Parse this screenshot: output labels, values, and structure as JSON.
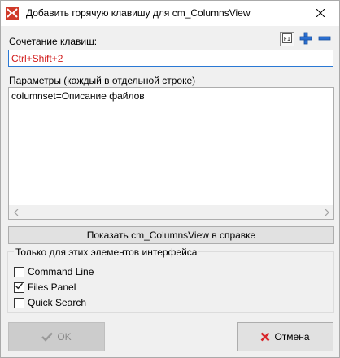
{
  "window": {
    "title": "Добавить горячую клавишу для cm_ColumnsView"
  },
  "hotkey": {
    "label_u": "С",
    "label_rest": "очетание клавиш:",
    "value": "Ctrl+Shift+2",
    "help_btn_label": "F1"
  },
  "params": {
    "label": "Параметры (каждый в отдельной строке)",
    "value": "columnset=Описание файлов"
  },
  "show_help_button": {
    "label": "Показать cm_ColumnsView в справке"
  },
  "scope_group": {
    "title": "Только для этих элементов интерфейса",
    "items": [
      {
        "label": "Command Line",
        "checked": false
      },
      {
        "label": "Files Panel",
        "checked": true
      },
      {
        "label": "Quick Search",
        "checked": false
      }
    ]
  },
  "buttons": {
    "ok": "OK",
    "cancel": "Отмена"
  },
  "icons": {
    "app": "double-commander-icon",
    "close": "close-icon",
    "help": "help-f1-icon",
    "add": "plus-icon",
    "remove": "minus-icon",
    "ok": "checkmark-icon",
    "cancel": "red-x-icon"
  },
  "colors": {
    "hotkey_text": "#d11a1a",
    "focus_border": "#2a78d4",
    "icon_blue": "#2b6fd0",
    "cancel_red": "#d9262b"
  }
}
